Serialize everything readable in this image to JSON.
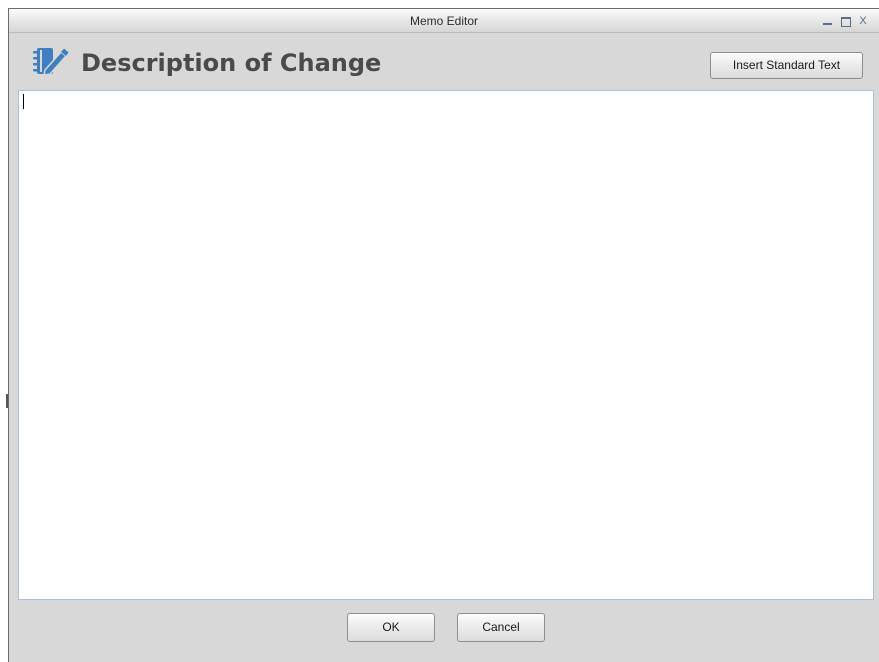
{
  "window": {
    "title": "Memo Editor",
    "controls": {
      "minimize": "minimize-icon",
      "maximize": "maximize-icon",
      "close_label": "X"
    }
  },
  "header": {
    "icon": "notebook-pencil-icon",
    "heading": "Description of Change",
    "insert_button": "Insert Standard Text"
  },
  "editor": {
    "value": ""
  },
  "footer": {
    "ok_button": "OK",
    "cancel_button": "Cancel"
  },
  "colors": {
    "accent_blue": "#3f7fbf",
    "dialog_bg": "#d8d8d8",
    "heading_text": "#4a4a4a"
  }
}
